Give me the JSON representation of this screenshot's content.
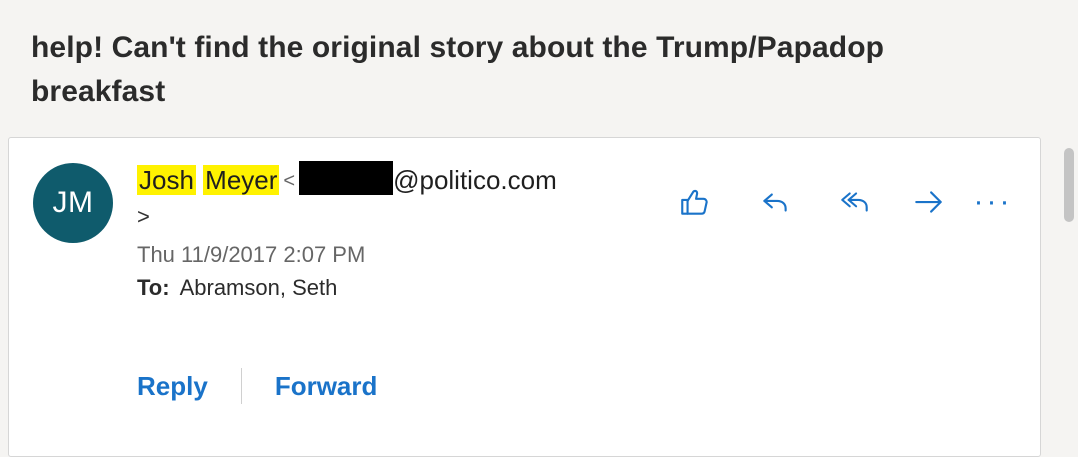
{
  "subject": "help! Can't find the original story about the Trump/Papadop breakfast",
  "sender": {
    "first_name": "Josh",
    "last_name": "Meyer",
    "open_bracket": "<",
    "email_domain": "@politico.com",
    "close_bracket": ">",
    "initials": "JM",
    "avatar_color": "#0f5b6c"
  },
  "date": "Thu 11/9/2017 2:07 PM",
  "to": {
    "label": "To:",
    "value": "Abramson, Seth"
  },
  "actions": [
    {
      "name": "like",
      "icon": "thumbs-up-icon"
    },
    {
      "name": "reply",
      "icon": "reply-icon"
    },
    {
      "name": "reply-all",
      "icon": "reply-all-icon"
    },
    {
      "name": "forward",
      "icon": "forward-arrow-icon"
    },
    {
      "name": "more",
      "icon": "more-icon",
      "label": "···"
    }
  ],
  "buttons": {
    "reply_label": "Reply",
    "forward_label": "Forward"
  },
  "colors": {
    "accent": "#1a73c9",
    "highlight": "#fff200"
  }
}
